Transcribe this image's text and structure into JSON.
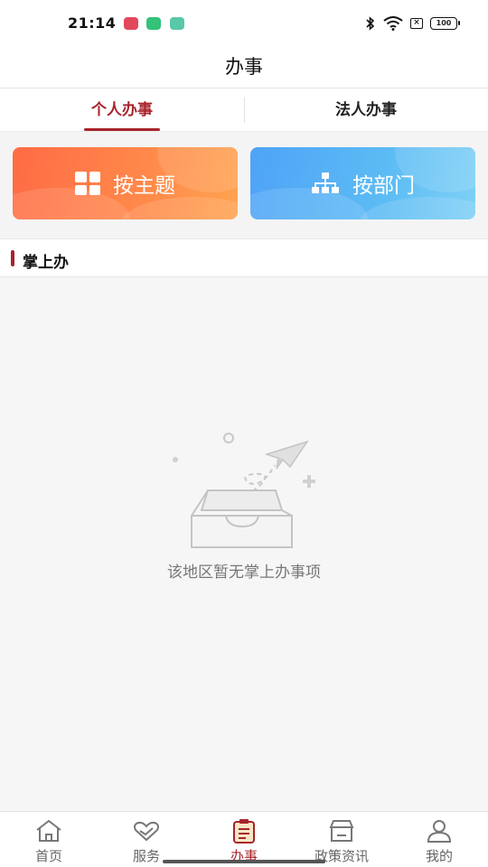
{
  "status": {
    "time": "21:14",
    "battery": "100",
    "icons": [
      "video-notification-icon",
      "app-notification-icon",
      "upload-notification-icon",
      "bluetooth-icon",
      "wifi-icon",
      "sim-off-icon",
      "battery-icon"
    ]
  },
  "header": {
    "title": "办事"
  },
  "tabs": [
    {
      "label": "个人办事",
      "active": true
    },
    {
      "label": "法人办事",
      "active": false
    }
  ],
  "categories": [
    {
      "label": "按主题",
      "icon": "grid-icon",
      "color": "#ff7a48"
    },
    {
      "label": "按部门",
      "icon": "org-chart-icon",
      "color": "#5cb6f5"
    }
  ],
  "section": {
    "title": "掌上办"
  },
  "empty": {
    "message": "该地区暂无掌上办事项",
    "icon": "empty-box-paper-plane-icon"
  },
  "bottom_nav": [
    {
      "label": "首页",
      "icon": "home-icon",
      "active": false
    },
    {
      "label": "服务",
      "icon": "heart-hands-icon",
      "active": false
    },
    {
      "label": "办事",
      "icon": "clipboard-icon",
      "active": true
    },
    {
      "label": "政策资讯",
      "icon": "shop-icon",
      "active": false
    },
    {
      "label": "我的",
      "icon": "user-icon",
      "active": false
    }
  ],
  "colors": {
    "accent": "#a8232b",
    "orange": "#ff7a48",
    "blue": "#5cb6f5"
  }
}
